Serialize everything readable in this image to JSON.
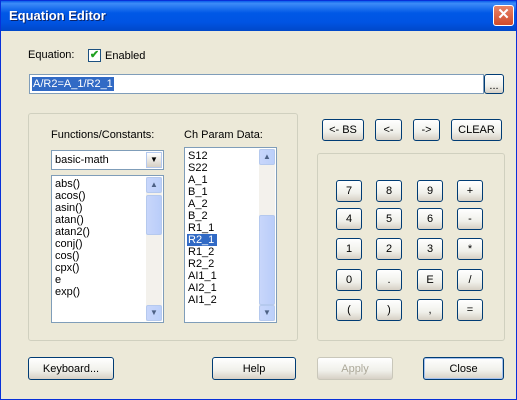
{
  "window": {
    "title": "Equation Editor",
    "close_glyph": "✕"
  },
  "equation": {
    "label": "Equation:",
    "enabled_label": "Enabled",
    "enabled_checked": true,
    "value": "A/R2=A_1/R2_1",
    "browse_label": "..."
  },
  "functions": {
    "header": "Functions/Constants:",
    "category": "basic-math",
    "items": [
      "abs()",
      "acos()",
      "asin()",
      "atan()",
      "atan2()",
      "conj()",
      "cos()",
      "cpx()",
      "e",
      "exp()"
    ]
  },
  "params": {
    "header": "Ch Param Data:",
    "items": [
      "S12",
      "S22",
      "A_1",
      "B_1",
      "A_2",
      "B_2",
      "R1_1",
      "R2_1",
      "R1_2",
      "R2_2",
      "AI1_1",
      "AI2_1",
      "AI1_2"
    ],
    "selected": "R2_1"
  },
  "edit_buttons": {
    "backspace": "<- BS",
    "left": "<-",
    "right": "->",
    "clear": "CLEAR"
  },
  "keypad": [
    [
      "7",
      "8",
      "9",
      "+"
    ],
    [
      "4",
      "5",
      "6",
      "-"
    ],
    [
      "1",
      "2",
      "3",
      "*"
    ],
    [
      "0",
      ".",
      "E",
      "/"
    ],
    [
      "(",
      ")",
      ",",
      "="
    ]
  ],
  "footer": {
    "keyboard": "Keyboard...",
    "help": "Help",
    "apply": "Apply",
    "close": "Close"
  }
}
